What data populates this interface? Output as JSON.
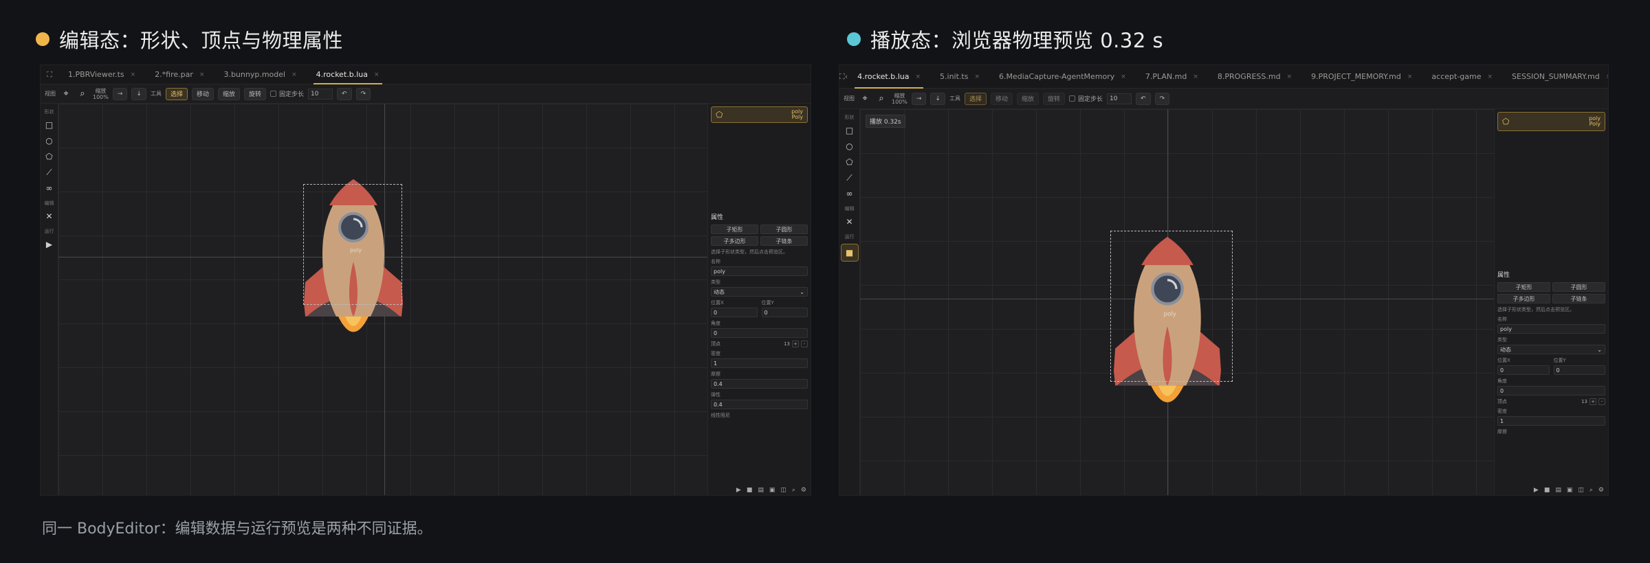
{
  "left": {
    "title": "编辑态：形状、顶点与物理属性",
    "dot_color": "#f0b64a",
    "tabs": [
      {
        "label": "1.PBRViewer.ts"
      },
      {
        "label": "2.*fire.par"
      },
      {
        "label": "3.bunnyp.model"
      },
      {
        "label": "4.rocket.b.lua"
      }
    ],
    "toolbar": {
      "view_label": "视图",
      "zoom_label": "缩放",
      "zoom_value": "100%",
      "tool_label": "工具",
      "select": "选择",
      "move": "移动",
      "scale": "缩放",
      "rotate": "旋转",
      "fixed_step": "固定步长",
      "step_value": "10"
    },
    "sidebar": {
      "shapes_group": "形状",
      "edit_group": "编辑",
      "run_group": "运行"
    },
    "canvas": {
      "body_label": "poly"
    },
    "shape_card": {
      "line1": "poly",
      "line2": "Poly"
    },
    "props": {
      "header": "属性",
      "add_rect": "子矩形",
      "add_circle": "子圆形",
      "add_poly": "子多边形",
      "add_chain": "子链条",
      "hint": "选择子形状类型，然后点击预览区。",
      "name_label": "名称",
      "name_value": "poly",
      "type_label": "类型",
      "type_value": "动态",
      "posx_label": "位置X",
      "posx_value": "0",
      "posy_label": "位置Y",
      "posy_value": "0",
      "angle_label": "角度",
      "angle_value": "0",
      "vertex_label": "顶点",
      "vertex_count": "13",
      "density_label": "密度",
      "density_value": "1",
      "friction_label": "摩擦",
      "friction_value": "0.4",
      "restitution_label": "弹性",
      "restitution_value": "0.4",
      "linear_damping_label": "线性阻尼"
    }
  },
  "right": {
    "title": "播放态：浏览器物理预览 0.32 s",
    "dot_color": "#5bc7d6",
    "tabs": [
      {
        "label": "4.rocket.b.lua"
      },
      {
        "label": "5.init.ts"
      },
      {
        "label": "6.MediaCapture-AgentMemory"
      },
      {
        "label": "7.PLAN.md"
      },
      {
        "label": "8.PROGRESS.md"
      },
      {
        "label": "9.PROJECT_MEMORY.md"
      },
      {
        "label": "accept-game"
      },
      {
        "label": "SESSION_SUMMARY.md"
      }
    ],
    "toolbar": {
      "view_label": "视图",
      "zoom_label": "缩放",
      "zoom_value": "100%",
      "tool_label": "工具",
      "select": "选择",
      "move": "移动",
      "scale": "缩放",
      "rotate": "旋转",
      "fixed_step": "固定步长",
      "step_value": "10"
    },
    "sidebar": {
      "shapes_group": "形状",
      "edit_group": "编辑",
      "run_group": "运行"
    },
    "canvas": {
      "body_label": "poly",
      "playing_hint": "播放 0.32s"
    },
    "shape_card": {
      "line1": "poly",
      "line2": "Poly"
    },
    "props": {
      "header": "属性",
      "add_rect": "子矩形",
      "add_circle": "子圆形",
      "add_poly": "子多边形",
      "add_chain": "子链条",
      "hint": "选择子形状类型，然后点击预览区。",
      "name_label": "名称",
      "name_value": "poly",
      "type_label": "类型",
      "type_value": "动态",
      "posx_label": "位置X",
      "posx_value": "0",
      "posy_label": "位置Y",
      "posy_value": "0",
      "angle_label": "角度",
      "angle_value": "0",
      "vertex_label": "顶点",
      "vertex_count": "13",
      "density_label": "密度",
      "density_value": "1",
      "friction_label": "摩擦"
    }
  },
  "caption": "同一 BodyEditor：编辑数据与运行预览是两种不同证据。",
  "colors": {
    "accent": "#d4b04e",
    "rocket_body": "#c9a27d",
    "rocket_nose": "#c65a4c",
    "flame": "#f4a13a"
  }
}
